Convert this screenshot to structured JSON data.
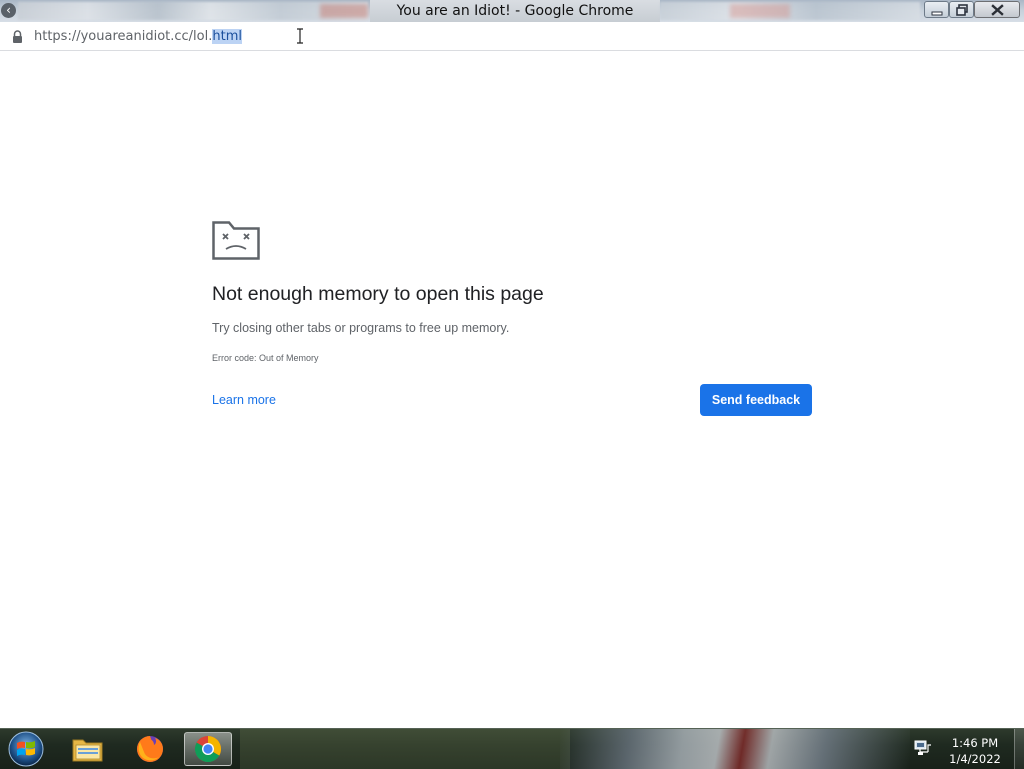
{
  "window": {
    "title": "You are an Idiot! - Google Chrome",
    "buttons": [
      "minimize-icon",
      "restore-icon",
      "close-icon"
    ]
  },
  "addressbar": {
    "url_prefix": "https://youareanidiot.cc/lol.",
    "url_selected": "html",
    "lock_icon": "lock-icon"
  },
  "error_page": {
    "icon": "sad-tab-icon",
    "heading": "Not enough memory to open this page",
    "suggestion": "Try closing other tabs or programs to free up memory.",
    "error_code": "Error code: Out of Memory",
    "learn_more": "Learn more",
    "send_feedback": "Send feedback",
    "accent_color": "#1a73e8"
  },
  "taskbar": {
    "start_icon": "windows-start-icon",
    "pinned": [
      {
        "name": "file-explorer-icon",
        "active": false
      },
      {
        "name": "firefox-icon",
        "active": false
      },
      {
        "name": "chrome-icon",
        "active": true
      }
    ],
    "tray_icon": "network-icon",
    "clock": {
      "time": "1:46 PM",
      "date": "1/4/2022"
    }
  }
}
